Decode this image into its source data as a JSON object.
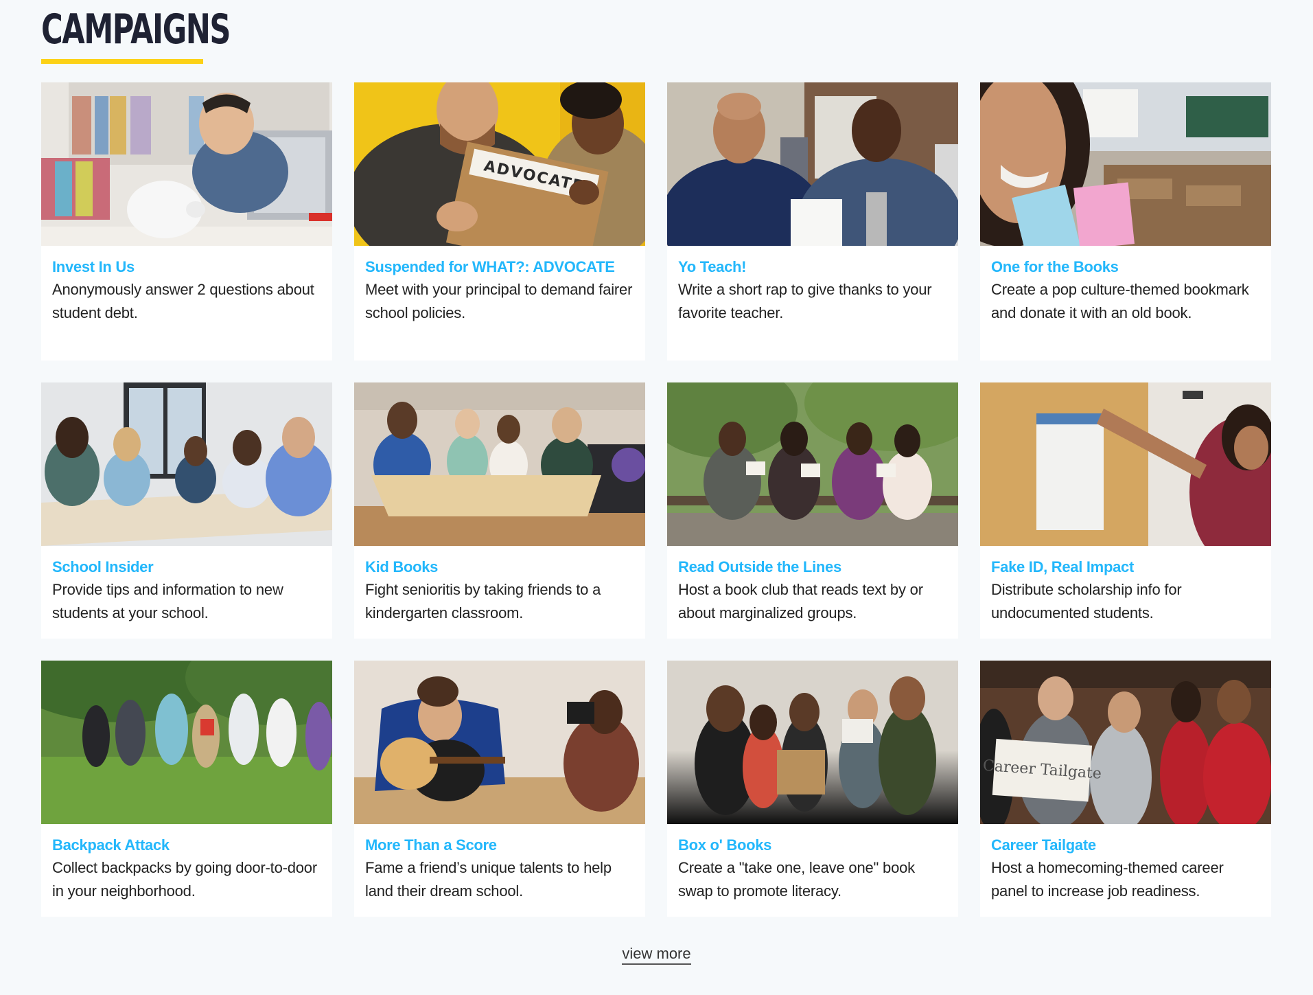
{
  "section": {
    "title": "CAMPAIGNS",
    "accent_color": "#fcd116"
  },
  "campaigns": [
    {
      "title": "Invest In Us",
      "description": "Anonymously answer 2 questions about student debt.",
      "photo": "stressed-student-piggy-bank-photo"
    },
    {
      "title": "Suspended for WHAT?: ADVOCATE",
      "description": "Meet with your principal to demand fairer school policies.",
      "photo": "advocate-clipboard-photo",
      "photo_text": "ADVOCATE"
    },
    {
      "title": "Yo Teach!",
      "description": "Write a short rap to give thanks to your favorite teacher.",
      "photo": "teacher-and-student-photo"
    },
    {
      "title": "One for the Books",
      "description": "Create a pop culture-themed bookmark and donate it with an old book.",
      "photo": "selfie-with-bookmarks-photo"
    },
    {
      "title": "School Insider",
      "description": "Provide tips and information to new students at your school.",
      "photo": "group-at-table-photo"
    },
    {
      "title": "Kid Books",
      "description": "Fight senioritis by taking friends to a kindergarten classroom.",
      "photo": "kids-at-table-photo"
    },
    {
      "title": "Read Outside the Lines",
      "description": "Host a book club that reads text by or about marginalized groups.",
      "photo": "reading-on-bench-photo"
    },
    {
      "title": "Fake ID, Real Impact",
      "description": "Distribute scholarship info for undocumented students.",
      "photo": "posting-flyer-photo"
    },
    {
      "title": "Backpack Attack",
      "description": "Collect backpacks by going door-to-door in your neighborhood.",
      "photo": "students-walking-park-photo"
    },
    {
      "title": "More Than a Score",
      "description": "Fame a friend’s unique talents to help land their dream school.",
      "photo": "guitar-and-photographer-photo"
    },
    {
      "title": "Box o' Books",
      "description": "Create a \"take one, leave one\" book swap to promote literacy.",
      "photo": "book-swap-group-photo"
    },
    {
      "title": "Career Tailgate",
      "description": "Host a homecoming-themed career panel to increase job readiness.",
      "photo": "career-tailgate-group-photo",
      "photo_text": "Career Tailgate"
    }
  ],
  "footer": {
    "view_more_label": "view more"
  },
  "colors": {
    "title_link": "#23b7fb",
    "background": "#f6f9fb",
    "heading": "#1f2233"
  }
}
